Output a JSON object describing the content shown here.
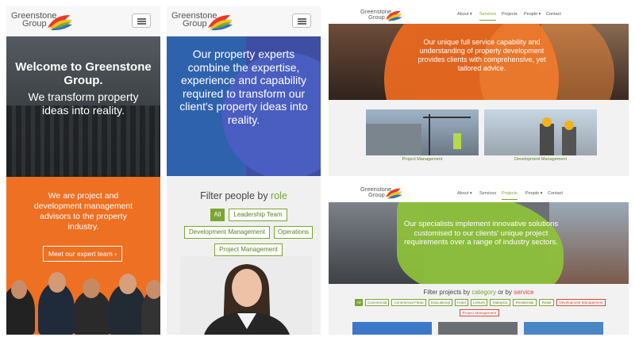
{
  "brand": {
    "line1": "Greenstone",
    "line2": "Group"
  },
  "panel1": {
    "title": "Welcome to Greenstone Group.",
    "subtitle": "We transform property ideas into reality.",
    "orange_text": "We are project and development management advisors to the property industry.",
    "cta_label": "Meet our expert team ›"
  },
  "panel2": {
    "hero_text": "Our property experts combine the expertise, experience and capability required to transform our client's property ideas into reality.",
    "filter_prefix": "Filter people by ",
    "filter_keyword": "role",
    "tags": [
      "All",
      "Leadership Team",
      "Development Management",
      "Operations",
      "Project Management"
    ]
  },
  "panel3": {
    "nav": [
      "About ▾",
      "Services",
      "Projects",
      "People ▾",
      "Contact"
    ],
    "active_nav": "Services",
    "hero_text": "Our unique full service capability and understanding of property development provides clients with comprehensive, yet tailored advice.",
    "cards": [
      "Project Management",
      "Development Management"
    ]
  },
  "panel4": {
    "nav": [
      "About ▾",
      "Services",
      "Projects",
      "People ▾",
      "Contact"
    ],
    "active_nav": "Projects",
    "hero_text": "Our specialists implement innovative solutions customised to our clients' unique project requirements over a range of industry sectors.",
    "filter_prefix": "Filter projects by ",
    "filter_category": "category",
    "filter_middle": " or by ",
    "filter_service": "service",
    "category_tags": [
      "All",
      "Commercial",
      "Commercial Fitout",
      "Educational",
      "Hotel",
      "Leisure",
      "Malaysia",
      "Residential",
      "Retail"
    ],
    "service_tags": [
      "Development Management",
      "Project Management"
    ]
  },
  "colors": {
    "green": "#7aa630",
    "orange": "#ee7022",
    "red": "#d34a3a",
    "blue": "#3d4ea3"
  }
}
